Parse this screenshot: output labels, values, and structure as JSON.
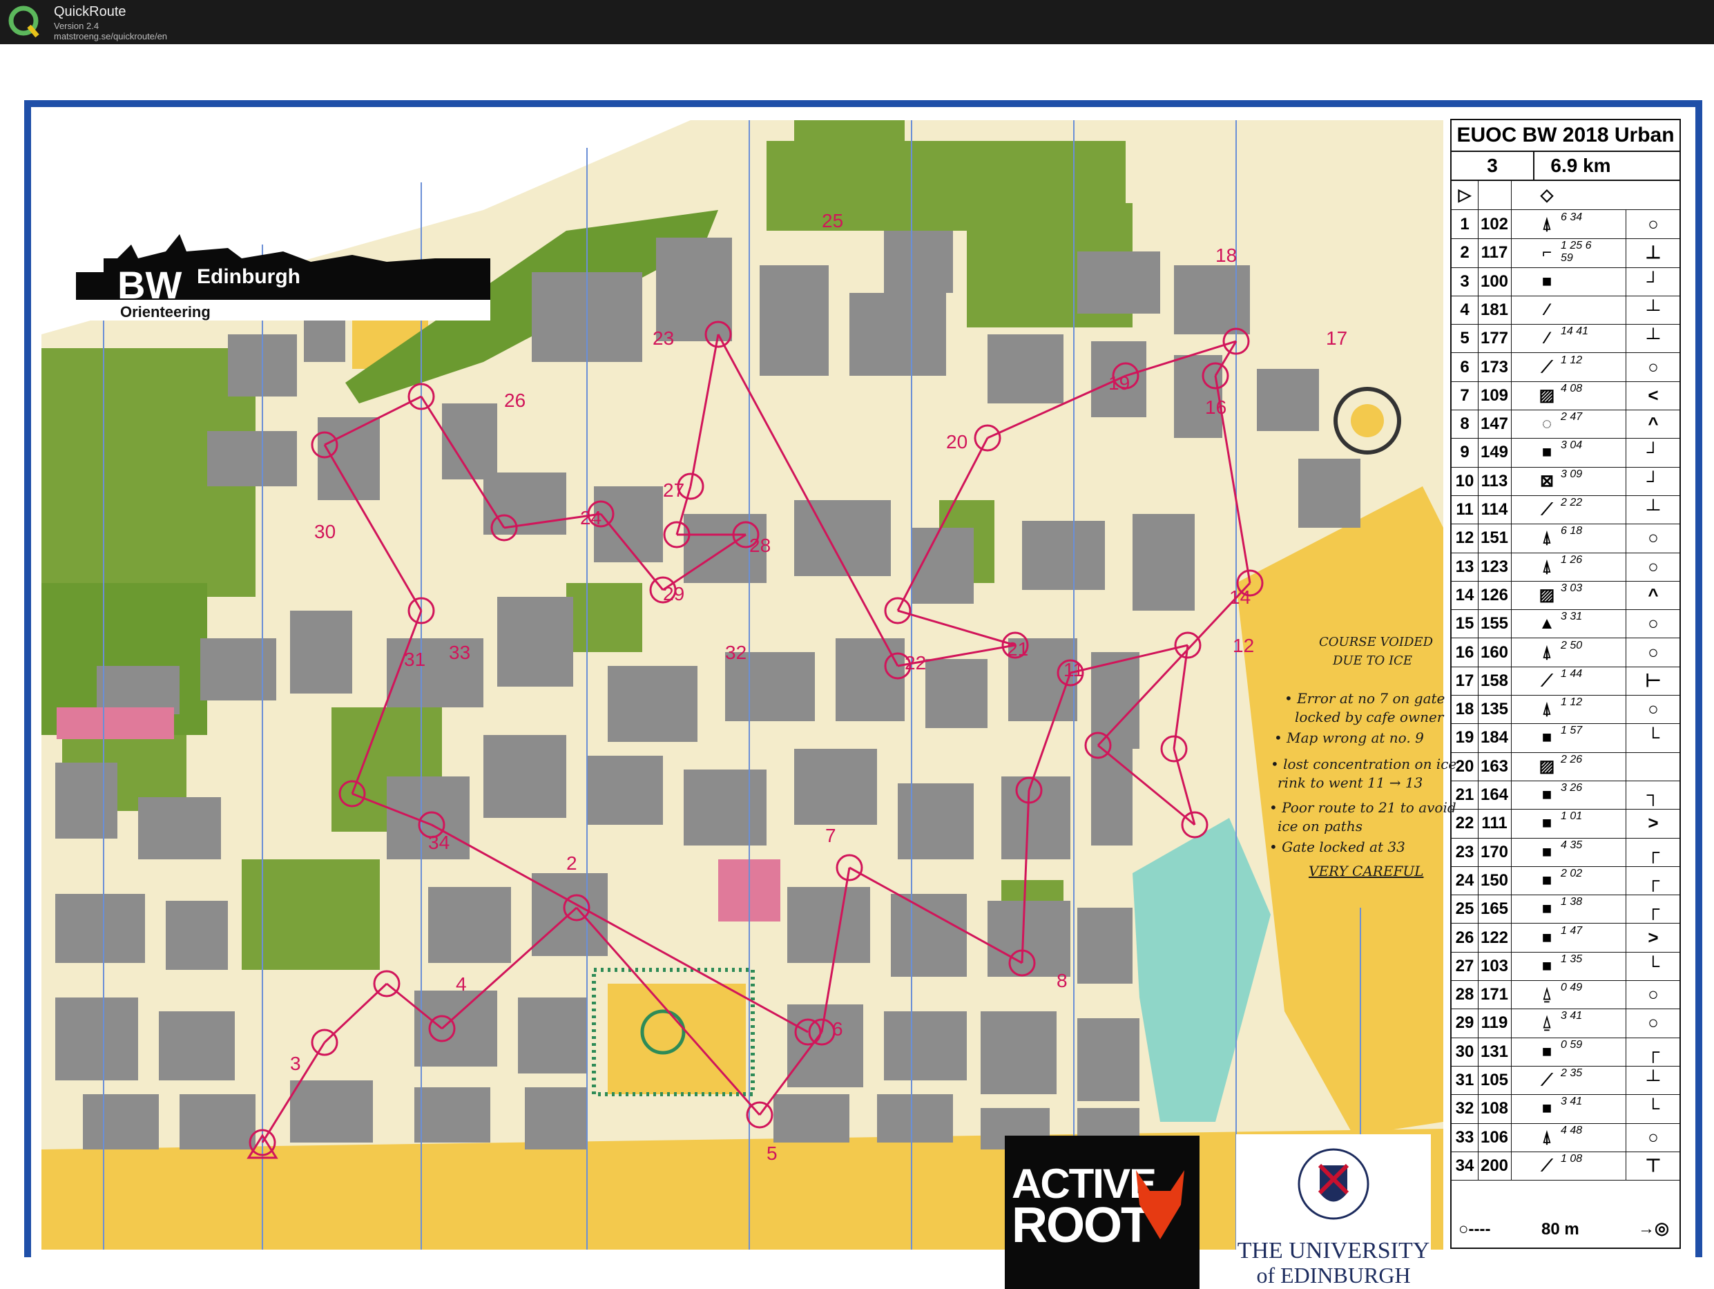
{
  "app": {
    "title": "QuickRoute",
    "version": "Version 2.4",
    "url": "matstroeng.se/quickroute/en"
  },
  "branding": {
    "bw_main": "BW",
    "bw_sub": "Edinburgh",
    "bw_orienteering": "Orienteering",
    "activeroot_line1": "ACTIVE",
    "activeroot_line2": "ROOT",
    "uoe_line1": "THE UNIVERSITY",
    "uoe_line2": "of EDINBURGH"
  },
  "colors": {
    "frame_blue": "#1f4fa8",
    "building_gray": "#8c8c8c",
    "vegetation_green": "#7aa23a",
    "open_yellow": "#f3c94d",
    "paved_cream": "#f4eccb",
    "course_magenta": "#d1155a",
    "water_teal": "#8fd6c8"
  },
  "control_card": {
    "title": "EUOC BW 2018 Urban",
    "course": "3",
    "length": "6.9 km",
    "start_symbol": "▷",
    "start_feature": "◇",
    "rows": [
      {
        "num": "1",
        "code": "102",
        "sym": "⍋",
        "dim": "6 34",
        "last": "○"
      },
      {
        "num": "2",
        "code": "117",
        "sym": "⌐",
        "dim": "1 25  6 59",
        "last": "⊥"
      },
      {
        "num": "3",
        "code": "100",
        "sym": "■",
        "dim": "",
        "last": "┘"
      },
      {
        "num": "4",
        "code": "181",
        "sym": "⁄",
        "dim": "",
        "last": "┴"
      },
      {
        "num": "5",
        "code": "177",
        "sym": "⁄",
        "dim": "14 41",
        "last": "┴"
      },
      {
        "num": "6",
        "code": "173",
        "sym": "⟋",
        "dim": "1 12",
        "last": "○"
      },
      {
        "num": "7",
        "code": "109",
        "sym": "▨",
        "dim": "4 08",
        "last": "<"
      },
      {
        "num": "8",
        "code": "147",
        "sym": "◌",
        "dim": "2 47",
        "last": "^"
      },
      {
        "num": "9",
        "code": "149",
        "sym": "■",
        "dim": "3 04",
        "last": "┘"
      },
      {
        "num": "10",
        "code": "113",
        "sym": "⊠",
        "dim": "3 09",
        "last": "┘"
      },
      {
        "num": "11",
        "code": "114",
        "sym": "⟋",
        "dim": "2 22",
        "last": "┴"
      },
      {
        "num": "12",
        "code": "151",
        "sym": "⍋",
        "dim": "6 18",
        "last": "○"
      },
      {
        "num": "13",
        "code": "123",
        "sym": "⍋",
        "dim": "1 26",
        "last": "○"
      },
      {
        "num": "14",
        "code": "126",
        "sym": "▨",
        "dim": "3 03",
        "last": "^"
      },
      {
        "num": "15",
        "code": "155",
        "sym": "▲",
        "dim": "3 31",
        "last": "○"
      },
      {
        "num": "16",
        "code": "160",
        "sym": "⍋",
        "dim": "2 50",
        "last": "○"
      },
      {
        "num": "17",
        "code": "158",
        "sym": "⟋",
        "dim": "1 44",
        "last": "⊢"
      },
      {
        "num": "18",
        "code": "135",
        "sym": "⍋",
        "dim": "1 12",
        "last": "○"
      },
      {
        "num": "19",
        "code": "184",
        "sym": "■",
        "dim": "1 57",
        "last": "└"
      },
      {
        "num": "20",
        "code": "163",
        "sym": "▨",
        "dim": "2 26",
        "last": ""
      },
      {
        "num": "21",
        "code": "164",
        "sym": "■",
        "dim": "3 26",
        "last": "┐"
      },
      {
        "num": "22",
        "code": "111",
        "sym": "■",
        "dim": "1 01",
        "last": ">"
      },
      {
        "num": "23",
        "code": "170",
        "sym": "■",
        "dim": "4 35",
        "last": "┌"
      },
      {
        "num": "24",
        "code": "150",
        "sym": "■",
        "dim": "2 02",
        "last": "┌"
      },
      {
        "num": "25",
        "code": "165",
        "sym": "■",
        "dim": "1 38",
        "last": "┌"
      },
      {
        "num": "26",
        "code": "122",
        "sym": "■",
        "dim": "1 47",
        "last": ">"
      },
      {
        "num": "27",
        "code": "103",
        "sym": "■",
        "dim": "1 35",
        "last": "└"
      },
      {
        "num": "28",
        "code": "171",
        "sym": "⍙",
        "dim": "0 49",
        "last": "○"
      },
      {
        "num": "29",
        "code": "119",
        "sym": "⍙",
        "dim": "3 41",
        "last": "○"
      },
      {
        "num": "30",
        "code": "131",
        "sym": "■",
        "dim": "0 59",
        "last": "┌"
      },
      {
        "num": "31",
        "code": "105",
        "sym": "⟋",
        "dim": "2 35",
        "last": "┴"
      },
      {
        "num": "32",
        "code": "108",
        "sym": "■",
        "dim": "3 41",
        "last": "└"
      },
      {
        "num": "33",
        "code": "106",
        "sym": "⍋",
        "dim": "4 48",
        "last": "○"
      },
      {
        "num": "34",
        "code": "200",
        "sym": "⟋",
        "dim": "1 08",
        "last": "⊤"
      }
    ],
    "finish": "80 m"
  },
  "handwritten_notes": {
    "voided_1": "COURSE VOIDED",
    "voided_2": "DUE TO ICE",
    "n1": "• Error at no 7 on gate",
    "n2": "locked by cafe owner",
    "n3": "• Map wrong at no. 9",
    "n4": "• lost concentration on ice",
    "n5": "rink to went 11 → 13",
    "n6": "• Poor route to 21 to avoid",
    "n7": "ice on paths",
    "n8": "• Gate locked at 33",
    "n9": "VERY CAREFUL"
  },
  "control_labels": [
    "2",
    "3",
    "4",
    "5",
    "6",
    "7",
    "8",
    "11",
    "12",
    "14",
    "16",
    "17",
    "18",
    "19",
    "20",
    "21",
    "22",
    "23",
    "24",
    "25",
    "26",
    "27",
    "28",
    "29",
    "30",
    "31",
    "32",
    "33",
    "34"
  ]
}
